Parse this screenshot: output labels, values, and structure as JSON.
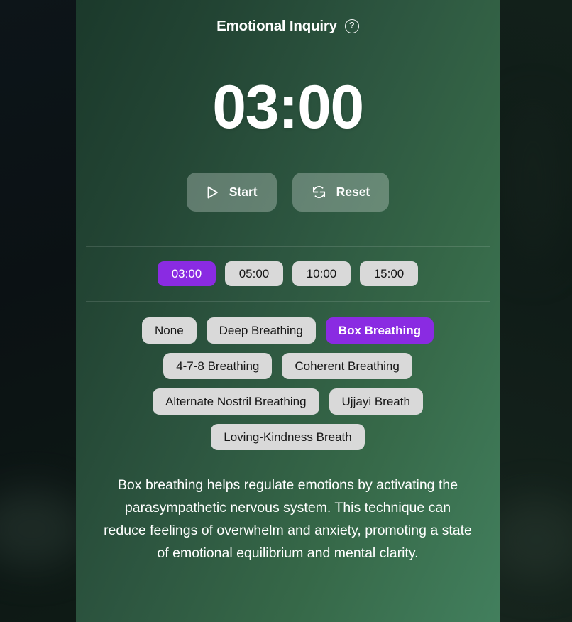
{
  "header": {
    "title": "Emotional Inquiry",
    "help_icon": "question-mark-circle-icon",
    "help_glyph": "?"
  },
  "timer": {
    "display": "03:00"
  },
  "controls": [
    {
      "label": "Start",
      "icon": "play-icon",
      "name": "start-button"
    },
    {
      "label": "Reset",
      "icon": "refresh-icon",
      "name": "reset-button"
    }
  ],
  "durations": {
    "options": [
      {
        "label": "03:00",
        "selected": true
      },
      {
        "label": "05:00",
        "selected": false
      },
      {
        "label": "10:00",
        "selected": false
      },
      {
        "label": "15:00",
        "selected": false
      }
    ]
  },
  "techniques": {
    "options": [
      {
        "label": "None",
        "selected": false
      },
      {
        "label": "Deep Breathing",
        "selected": false
      },
      {
        "label": "Box Breathing",
        "selected": true
      },
      {
        "label": "4-7-8 Breathing",
        "selected": false
      },
      {
        "label": "Coherent Breathing",
        "selected": false
      },
      {
        "label": "Alternate Nostril Breathing",
        "selected": false
      },
      {
        "label": "Ujjayi Breath",
        "selected": false
      },
      {
        "label": "Loving-Kindness Breath",
        "selected": false
      }
    ]
  },
  "description": {
    "text": "Box breathing helps regulate emotions by activating the parasympathetic nervous system. This technique can reduce feelings of overwhelm and anxiety, promoting a state of emotional equilibrium and mental clarity."
  },
  "colors": {
    "accent_purple": "#8a2be2",
    "chip_gray": "#d9d9d9",
    "panel_green_dark": "#1b392b",
    "panel_green_light": "#427f5d",
    "backdrop_dark": "#0c1316",
    "text_light": "#ffffff"
  }
}
